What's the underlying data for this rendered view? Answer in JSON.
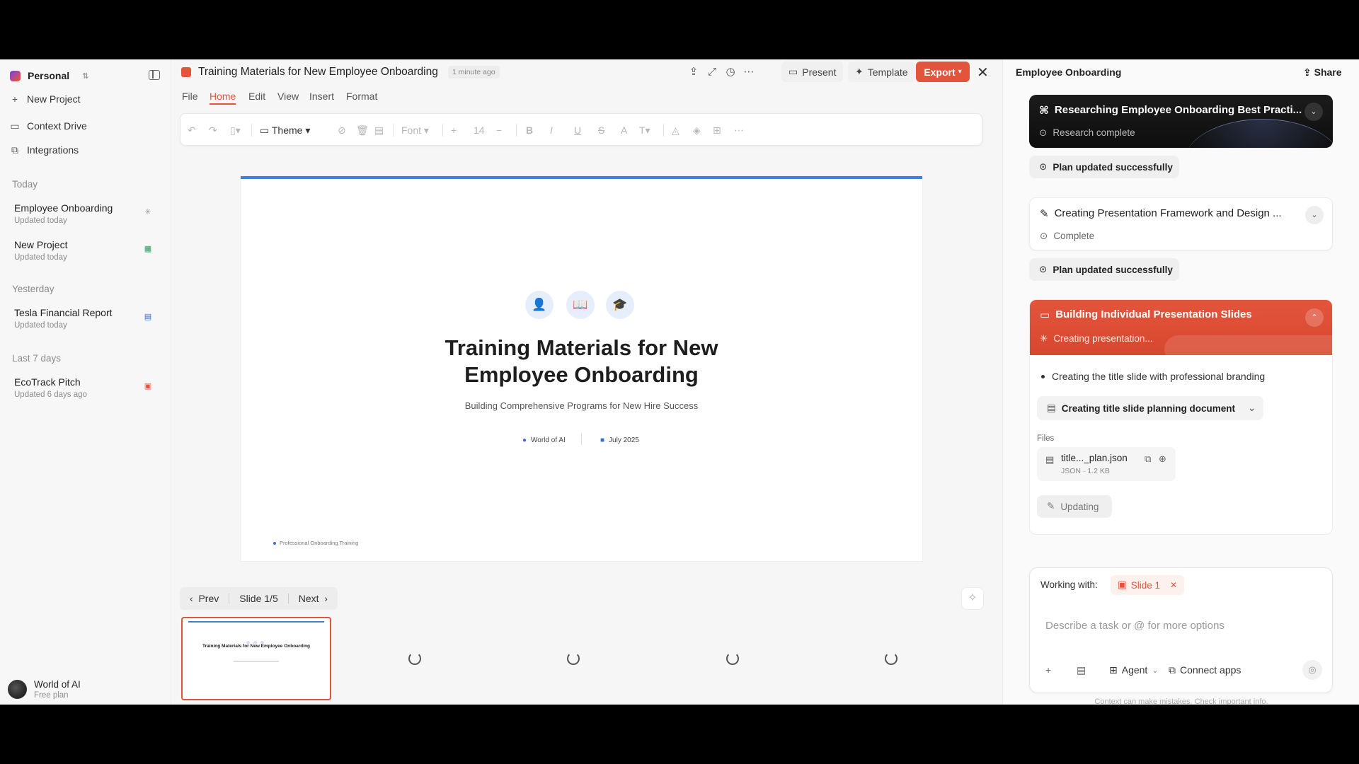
{
  "sidebar": {
    "workspace": "Personal",
    "nav": [
      {
        "label": "New Project",
        "icon": "plus-icon"
      },
      {
        "label": "Context Drive",
        "icon": "folder-icon"
      },
      {
        "label": "Integrations",
        "icon": "puzzle-icon"
      }
    ],
    "sections": {
      "today": "Today",
      "yesterday": "Yesterday",
      "last7": "Last 7 days"
    },
    "projects": [
      {
        "title": "Employee Onboarding",
        "sub": "Updated today",
        "icon": "loading-spinner-icon"
      },
      {
        "title": "New Project",
        "sub": "Updated today",
        "icon": "sheet-icon"
      },
      {
        "title": "Tesla Financial Report",
        "sub": "Updated today",
        "icon": "document-icon"
      },
      {
        "title": "EcoTrack Pitch",
        "sub": "Updated 6 days ago",
        "icon": "presentation-icon"
      }
    ],
    "user": {
      "name": "World of AI",
      "plan": "Free plan"
    }
  },
  "editor": {
    "title": "Training Materials for New Employee Onboarding",
    "updated": "1 minute ago",
    "present": "Present",
    "template": "Template",
    "export": "Export",
    "menu": [
      "File",
      "Home",
      "Edit",
      "View",
      "Insert",
      "Format"
    ],
    "toolbar": {
      "theme": "Theme",
      "font": "Font",
      "size": "14"
    },
    "slide": {
      "title_line1": "Training Materials for New",
      "title_line2": "Employee Onboarding",
      "subtitle": "Building Comprehensive Programs for New Hire Success",
      "author": "World of AI",
      "date": "July 2025",
      "footer": "Professional Onboarding Training"
    },
    "pager": {
      "prev": "Prev",
      "current": "Slide 1/5",
      "next": "Next"
    },
    "thumb": {
      "title": "Training Materials for New Employee Onboarding"
    }
  },
  "panel": {
    "title": "Employee Onboarding",
    "share": "Share",
    "research": {
      "title": "Researching Employee Onboarding Best Practi...",
      "status": "Research complete"
    },
    "plan_updated_1": "Plan updated successfully",
    "framework": {
      "title": "Creating Presentation Framework and Design ...",
      "status": "Complete"
    },
    "plan_updated_2": "Plan updated successfully",
    "building": {
      "title": "Building Individual Presentation Slides",
      "status": "Creating presentation...",
      "bullet": "Creating the title slide with professional branding",
      "planning": "Creating title slide planning document",
      "files_label": "Files",
      "file_name": "title..._plan.json",
      "file_meta": "JSON · 1.2 KB",
      "updating": "Updating"
    },
    "composer": {
      "working_with": "Working with:",
      "chip": "Slide 1",
      "placeholder": "Describe a task or @ for more options",
      "agent": "Agent",
      "connect": "Connect apps"
    },
    "disclaimer": "Context can make mistakes. Check important info."
  },
  "colors": {
    "accent": "#e2553c",
    "slide_bar": "#3b82d6",
    "dark_card": "#141414"
  }
}
